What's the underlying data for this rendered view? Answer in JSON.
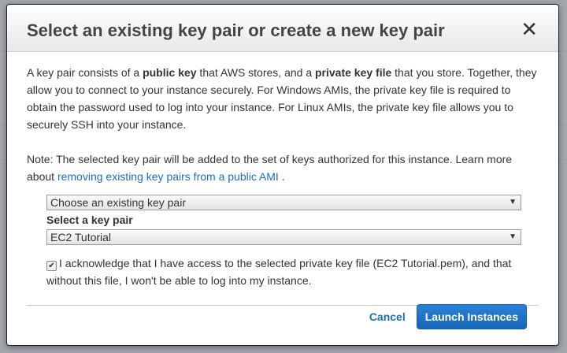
{
  "dialog": {
    "title": "Select an existing key pair or create a new key pair",
    "close_label": "✕",
    "intro": {
      "t1": "A key pair consists of a ",
      "b1": "public key",
      "t2": " that AWS stores, and a ",
      "b2": "private key file",
      "t3": " that you store. Together, they allow you to connect to your instance securely. For Windows AMIs, the private key file is required to obtain the password used to log into your instance. For Linux AMIs, the private key file allows you to securely SSH into your instance."
    },
    "note": {
      "text": "Note: The selected key pair will be added to the set of keys authorized for this instance. Learn more about ",
      "link": "removing existing key pairs from a public AMI",
      "end": "."
    },
    "mode_select": {
      "value": "Choose an existing key pair"
    },
    "key_label": "Select a key pair",
    "key_select": {
      "value": "EC2 Tutorial"
    },
    "acknowledge": {
      "checked": true,
      "text": "I acknowledge that I have access to the selected private key file (EC2 Tutorial.pem), and that without this file, I won't be able to log into my instance."
    },
    "cancel_label": "Cancel",
    "launch_label": "Launch Instances"
  }
}
